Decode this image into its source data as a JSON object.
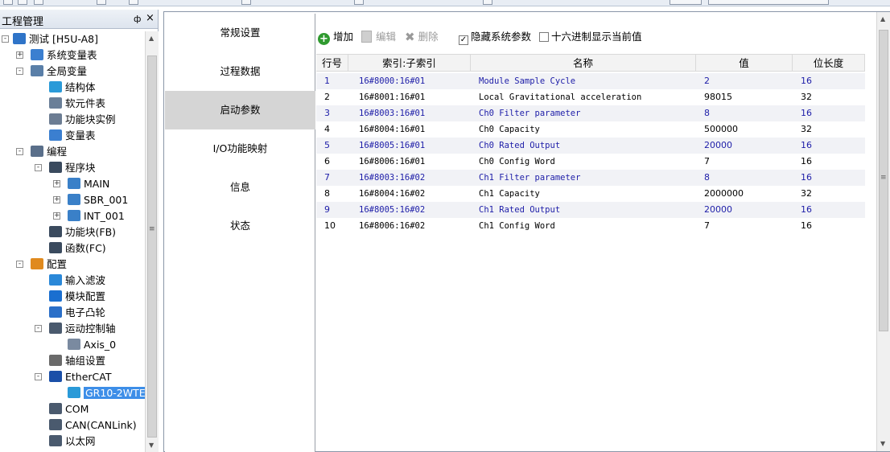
{
  "panel": {
    "title": "工程管理",
    "pin": "ф",
    "close": "×"
  },
  "tree": [
    {
      "label": "测试 [H5U-A8]",
      "icon": "monitor-icon",
      "color": "#2f74c8"
    },
    {
      "label": "系统变量表",
      "icon": "gear-globe-icon",
      "color": "#3b7fd0"
    },
    {
      "label": "全局变量",
      "icon": "document-icon",
      "color": "#5a7fa8"
    },
    {
      "label": "结构体",
      "icon": "struct-icon",
      "color": "#2a9ad8"
    },
    {
      "label": "软元件表",
      "icon": "table-icon",
      "color": "#6a7f98"
    },
    {
      "label": "功能块实例",
      "icon": "cube-icon",
      "color": "#6c7d93"
    },
    {
      "label": "变量表",
      "icon": "gear-globe-icon",
      "color": "#3b7fd0"
    },
    {
      "label": "编程",
      "icon": "ladder-icon",
      "color": "#5a6f8a"
    },
    {
      "label": "程序块",
      "icon": "blocks-icon",
      "color": "#3a4a5e"
    },
    {
      "label": "MAIN",
      "icon": "program-icon",
      "color": "#3a80c8"
    },
    {
      "label": "SBR_001",
      "icon": "program-icon",
      "color": "#3a80c8"
    },
    {
      "label": "INT_001",
      "icon": "program-icon",
      "color": "#3a80c8"
    },
    {
      "label": "功能块(FB)",
      "icon": "list-icon",
      "color": "#3a4a5e"
    },
    {
      "label": "函数(FC)",
      "icon": "list-icon",
      "color": "#3a4a5e"
    },
    {
      "label": "配置",
      "icon": "config-icon",
      "color": "#e08a1e"
    },
    {
      "label": "输入滤波",
      "icon": "wave-icon",
      "color": "#2a88d8"
    },
    {
      "label": "模块配置",
      "icon": "module-gear-icon",
      "color": "#1a6fd0"
    },
    {
      "label": "电子凸轮",
      "icon": "cam-icon",
      "color": "#2a6fc8"
    },
    {
      "label": "运动控制轴",
      "icon": "axis-icon",
      "color": "#4a5a6e"
    },
    {
      "label": "Axis_0",
      "icon": "axis-instance-icon",
      "color": "#7a8aa0"
    },
    {
      "label": "轴组设置",
      "icon": "gear-icon",
      "color": "#6a6a6a"
    },
    {
      "label": "EtherCAT",
      "icon": "ethercat-icon",
      "color": "#1a4fa8"
    },
    {
      "label": "GR10-2WTE",
      "icon": "device-icon",
      "color": "#2a9ad8"
    },
    {
      "label": "COM",
      "icon": "com-icon",
      "color": "#4a5a6e"
    },
    {
      "label": "CAN(CANLink)",
      "icon": "network-icon",
      "color": "#4a5a6e"
    },
    {
      "label": "以太网",
      "icon": "ethernet-icon",
      "color": "#4a5a6e"
    }
  ],
  "side_tabs": [
    "常规设置",
    "过程数据",
    "启动参数",
    "I/O功能映射",
    "信息",
    "状态"
  ],
  "actions": {
    "add": "增加",
    "edit": "编辑",
    "delete": "删除",
    "hide_system": "隐藏系统参数",
    "hex_display": "十六进制显示当前值"
  },
  "table": {
    "columns": [
      "行号",
      "索引:子索引",
      "名称",
      "值",
      "位长度"
    ],
    "rows": [
      [
        "1",
        "16#8000:16#01",
        "Module Sample Cycle",
        "2",
        "16"
      ],
      [
        "2",
        "16#8001:16#01",
        "Local Gravitational acceleration",
        "98015",
        "32"
      ],
      [
        "3",
        "16#8003:16#01",
        "Ch0 Filter parameter",
        "8",
        "16"
      ],
      [
        "4",
        "16#8004:16#01",
        "Ch0 Capacity",
        "500000",
        "32"
      ],
      [
        "5",
        "16#8005:16#01",
        "Ch0 Rated Output",
        "20000",
        "16"
      ],
      [
        "6",
        "16#8006:16#01",
        "Ch0 Config Word",
        "7",
        "16"
      ],
      [
        "7",
        "16#8003:16#02",
        "Ch1 Filter parameter",
        "8",
        "16"
      ],
      [
        "8",
        "16#8004:16#02",
        "Ch1 Capacity",
        "2000000",
        "32"
      ],
      [
        "9",
        "16#8005:16#02",
        "Ch1 Rated Output",
        "20000",
        "16"
      ],
      [
        "10",
        "16#8006:16#02",
        "Ch1 Config Word",
        "7",
        "16"
      ]
    ]
  },
  "state": {
    "active_tab": "启动参数",
    "selected_node": "GR10-2WTE",
    "hide_system_checked": true,
    "hex_display_checked": false
  }
}
